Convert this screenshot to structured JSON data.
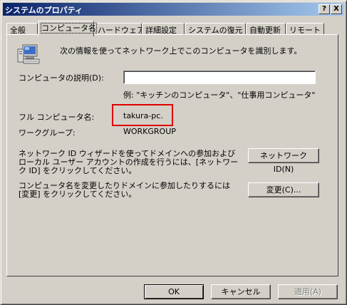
{
  "window": {
    "title": "システムのプロパティ",
    "help_btn": "?",
    "close_btn": "X"
  },
  "tabs": [
    {
      "label": "全般"
    },
    {
      "label": "コンピュータ名"
    },
    {
      "label": "ハードウェア"
    },
    {
      "label": "詳細設定"
    },
    {
      "label": "システムの復元"
    },
    {
      "label": "自動更新"
    },
    {
      "label": "リモート"
    }
  ],
  "main": {
    "intro_text": "次の情報を使ってネットワーク上でこのコンピュータを識別します。",
    "description_label": "コンピュータの説明(D):",
    "description_value": "",
    "example_text": "例: \"キッチンのコンピュータ\"、\"仕事用コンピュータ\"",
    "full_name_label": "フル コンピュータ名:",
    "full_name_value": "takura-pc.",
    "workgroup_label": "ワークグループ:",
    "workgroup_value": "WORKGROUP",
    "network_id_text": "ネットワーク ID ウィザードを使ってドメインへの参加およびローカル ユーザー アカウントの作成を行うには、[ネットワーク ID] をクリックしてください。",
    "network_id_button": "ネットワーク ID(N)",
    "change_text": "コンピュータ名を変更したりドメインに参加したりするには [変更] をクリックしてください。",
    "change_button": "変更(C)..."
  },
  "footer": {
    "ok": "OK",
    "cancel": "キャンセル",
    "apply": "適用(A)"
  },
  "colors": {
    "highlight_border": "#e00000",
    "titlebar_start": "#0a246a",
    "titlebar_end": "#a6caf0"
  }
}
